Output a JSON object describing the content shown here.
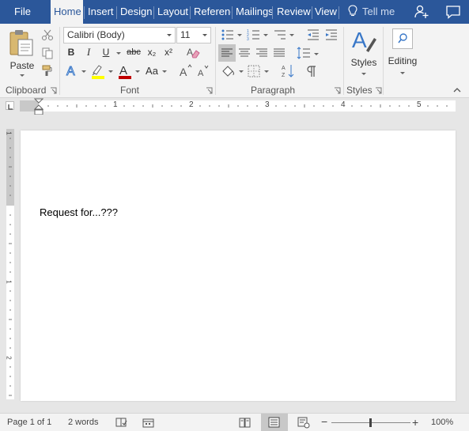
{
  "tabs": [
    {
      "label": "File",
      "active": false
    },
    {
      "label": "Home",
      "active": true
    },
    {
      "label": "Insert",
      "active": false
    },
    {
      "label": "Design",
      "active": false
    },
    {
      "label": "Layout",
      "active": false
    },
    {
      "label": "Referenc",
      "active": false
    },
    {
      "label": "Mailings",
      "active": false
    },
    {
      "label": "Review",
      "active": false
    },
    {
      "label": "View",
      "active": false
    }
  ],
  "tell_me": "Tell me",
  "ribbon": {
    "clipboard": {
      "paste_label": "Paste",
      "group_label": "Clipboard"
    },
    "font": {
      "font_name": "Calibri (Body)",
      "font_size": "11",
      "bold": "B",
      "italic": "I",
      "underline": "U",
      "strike": "abc",
      "subscript": "x₂",
      "superscript": "x²",
      "change_case": "Aa",
      "group_label": "Font"
    },
    "paragraph": {
      "group_label": "Paragraph"
    },
    "styles": {
      "button_label": "Styles",
      "group_label": "Styles"
    },
    "editing": {
      "button_label": "Editing"
    }
  },
  "ruler": {
    "numbers": [
      "1",
      "2",
      "3",
      "4",
      "5"
    ]
  },
  "vruler": {
    "numbers": [
      "1",
      "1",
      "2"
    ]
  },
  "document": {
    "body_text": "Request for...???"
  },
  "status": {
    "page": "Page 1 of 1",
    "words": "2 words",
    "zoom": "100%",
    "zoom_minus": "−",
    "zoom_plus": "+"
  },
  "colors": {
    "accent": "#2b579a",
    "font_color_bar": "#c00000",
    "highlight_bar": "#ffff00"
  }
}
